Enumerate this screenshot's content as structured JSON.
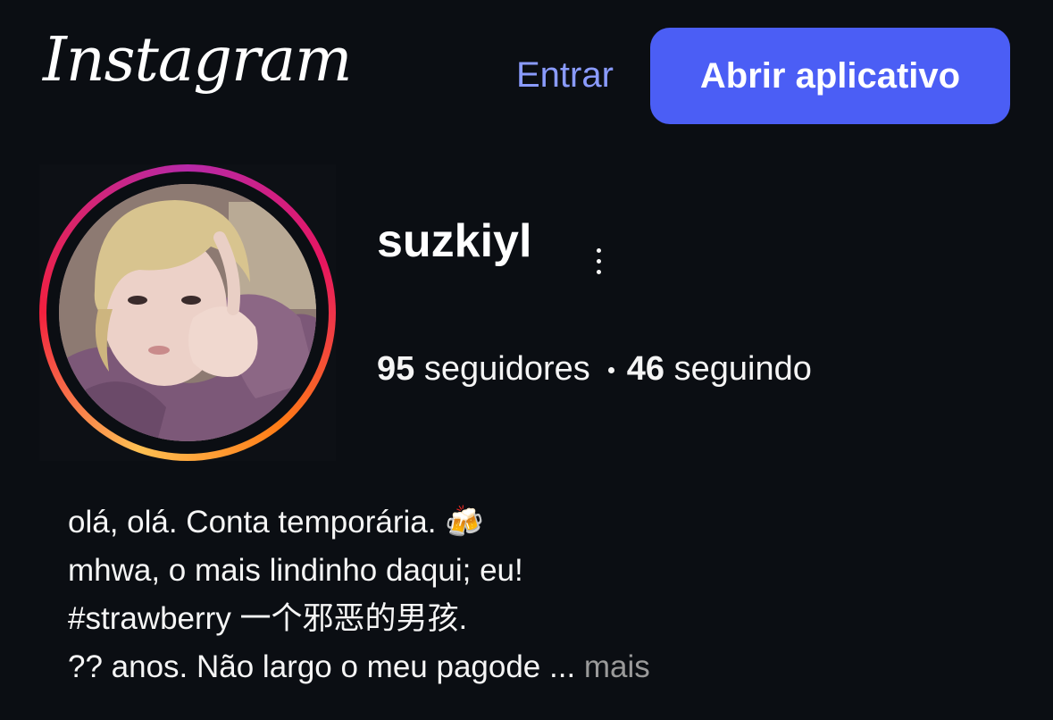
{
  "header": {
    "logo": "Instagram",
    "login_label": "Entrar",
    "open_app_label": "Abrir aplicativo"
  },
  "profile": {
    "username": "suzkiyl",
    "followers_count": "95",
    "followers_label": "seguidores",
    "following_count": "46",
    "following_label": "seguindo",
    "bio_lines": [
      "olá, olá. Conta temporária. 🍻",
      "mhwa, o mais lindinho daqui; eu!",
      "#strawberry 一个邪恶的男孩.",
      "?? anos. Não largo o meu pagode ..."
    ],
    "more_label": "mais"
  },
  "colors": {
    "background": "#0b0e13",
    "accent_button": "#4b5ef5",
    "link": "#8a9bff",
    "muted": "#9a9a9a"
  },
  "icons": {
    "more_options": "vertical-ellipsis-icon"
  }
}
